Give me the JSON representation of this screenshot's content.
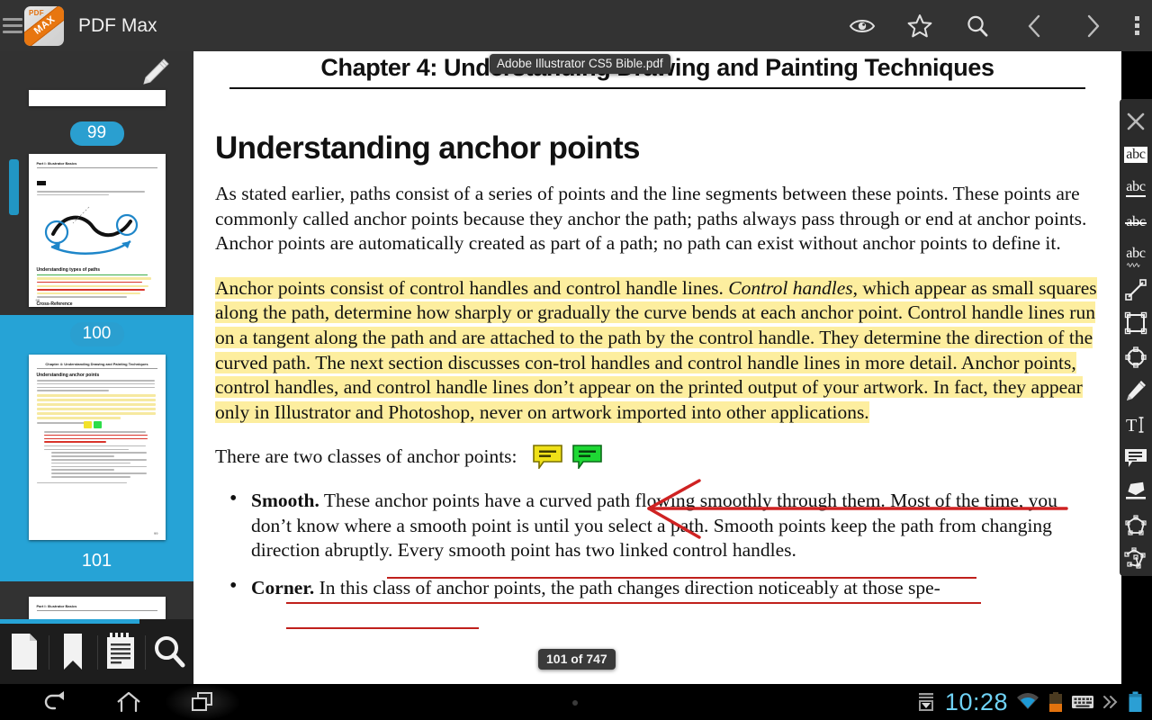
{
  "appbar": {
    "title": "PDF Max",
    "logo_text": "MAX",
    "logo_sub": "PDF",
    "actions": [
      {
        "name": "eye-icon",
        "label": "View Mode"
      },
      {
        "name": "star-icon",
        "label": "Bookmark"
      },
      {
        "name": "search-icon",
        "label": "Search"
      },
      {
        "name": "chevron-left-icon",
        "label": "Previous Page"
      },
      {
        "name": "chevron-right-icon",
        "label": "Next Page"
      },
      {
        "name": "overflow-menu-icon",
        "label": "More Options"
      }
    ]
  },
  "sidebar": {
    "thumbnails": [
      {
        "page": "99",
        "selected": false
      },
      {
        "page": "100",
        "selected": true
      },
      {
        "page": "101",
        "selected": false
      }
    ],
    "tabs": [
      {
        "name": "pages-tab",
        "label": "Pages"
      },
      {
        "name": "bookmarks-tab",
        "label": "Bookmarks"
      },
      {
        "name": "outline-tab",
        "label": "Outline"
      },
      {
        "name": "search-tab",
        "label": "Search"
      }
    ],
    "thumb_header": "Part I: Illustrator Basics",
    "thumb_chapter": "Chapter 4: Understanding Drawing and Painting Techniques",
    "thumb_section": "Understanding anchor points",
    "thumb_section_99": "Understanding types of paths",
    "thumb_note_99": "Cross-Reference",
    "thumb_pageno_99": "98",
    "thumb_pageno_100": "99"
  },
  "document": {
    "tooltip": "Adobe Illustrator CS5 Bible.pdf",
    "page_indicator": "101 of 747",
    "running_head": "Chapter 4: Understanding Drawing and Painting Techniques",
    "section_title": "Understanding anchor points",
    "paragraph_1": "As stated earlier, paths consist of a series of points and the line segments between these points. These points are commonly called anchor points because they anchor the path; paths always pass through or end at anchor points. Anchor points are automatically created as part of a path; no path can exist without anchor points to define it.",
    "highlighted_paragraph": {
      "part_1": "Anchor points consist of control handles and control handle lines. ",
      "italic": "Control handles",
      "part_2": ", which appear as small squares along the path, determine how sharply or gradually the curve bends at each anchor point. Control handle lines run on a tangent along the path and are attached to the path by the control handle. They determine the direction of the curved path. The next section discusses con-trol handles and control handle lines in more detail. Anchor points, control handles, and control handle lines don’t appear on the printed output of your artwork. In fact, they appear only in Illustrator and Photoshop, never on artwork imported into other applications.",
      "highlight_color": "#fdee9f"
    },
    "two_classes_line": "There are two classes of anchor points:",
    "inline_notes": [
      {
        "name": "sticky-note-yellow",
        "color": "#efe018"
      },
      {
        "name": "sticky-note-green",
        "color": "#1ed834"
      }
    ],
    "bullets": [
      {
        "term": "Smooth.",
        "text": " These anchor points have a curved path flowing smoothly through them. Most of the time, you don’t know where a smooth point is until you select a path. Smooth points keep the path from changing direction abruptly. Every smooth point has two linked control handles."
      },
      {
        "term": "Corner.",
        "text": " In this class of anchor points, the path changes direction noticeably at those spe-"
      }
    ],
    "annotation_colors": {
      "red": "#c0201c",
      "highlight_yellow": "#fdee9f"
    }
  },
  "annotation_toolbar": {
    "tools": [
      {
        "name": "close-icon",
        "label": "Close"
      },
      {
        "name": "highlight-text-icon",
        "label": "Highlight",
        "glyph": "abc"
      },
      {
        "name": "underline-text-icon",
        "label": "Underline",
        "glyph": "abc"
      },
      {
        "name": "strikethrough-text-icon",
        "label": "Strikethrough",
        "glyph": "abc"
      },
      {
        "name": "squiggly-text-icon",
        "label": "Squiggly Underline",
        "glyph": "abc"
      },
      {
        "name": "line-tool-icon",
        "label": "Line"
      },
      {
        "name": "rectangle-tool-icon",
        "label": "Rectangle"
      },
      {
        "name": "ellipse-tool-icon",
        "label": "Ellipse"
      },
      {
        "name": "pencil-tool-icon",
        "label": "Freehand"
      },
      {
        "name": "text-tool-icon",
        "label": "Text Box"
      },
      {
        "name": "note-tool-icon",
        "label": "Sticky Note"
      },
      {
        "name": "eraser-tool-icon",
        "label": "Eraser"
      },
      {
        "name": "polygon-tool-icon",
        "label": "Polygon"
      },
      {
        "name": "polyline-tool-icon",
        "label": "Polyline"
      }
    ]
  },
  "navbar": {
    "buttons": [
      {
        "name": "back-button",
        "label": "Back"
      },
      {
        "name": "home-button",
        "label": "Home"
      },
      {
        "name": "recent-apps-button",
        "label": "Recent Apps"
      }
    ],
    "clock": "10:28",
    "status_icons": [
      {
        "name": "download-icon",
        "label": "Download"
      },
      {
        "name": "wifi-icon",
        "label": "Wi-Fi"
      },
      {
        "name": "battery-charging-icon",
        "label": "Battery"
      },
      {
        "name": "keyboard-icon",
        "label": "Keyboard"
      },
      {
        "name": "expand-chevrons-icon",
        "label": "Expand"
      },
      {
        "name": "battery-level-icon",
        "label": "Battery Level"
      }
    ],
    "clock_color": "#6fd2f5"
  }
}
